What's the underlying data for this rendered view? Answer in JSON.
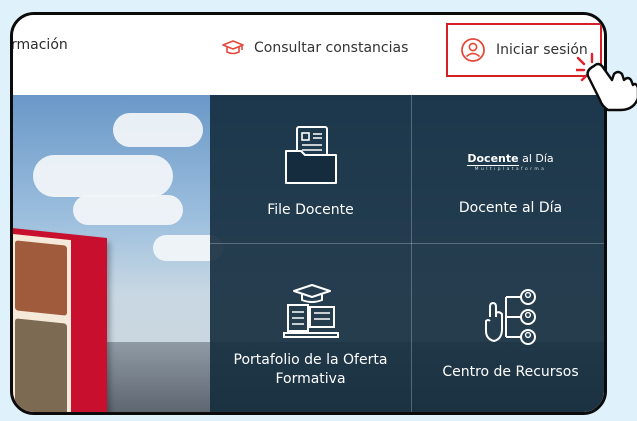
{
  "header": {
    "brand_fragment": "rmación",
    "consultar_label": "Consultar constancias",
    "login_label": "Iniciar sesión"
  },
  "tiles": [
    {
      "label": "File Docente",
      "icon": "folder-file-icon"
    },
    {
      "label": "Docente al Día",
      "icon": "docente-al-dia-logo"
    },
    {
      "label": "Portafolio de la Oferta Formativa",
      "icon": "graduation-laptop-icon"
    },
    {
      "label": "Centro de Recursos",
      "icon": "network-users-icon"
    }
  ],
  "docente_logo": {
    "bold": "Docente",
    "rest": " al Día",
    "sub": "Multiplataforma"
  },
  "colors": {
    "accent_red": "#d61f26",
    "panel_navy": "#142c3e",
    "outer_bg": "#dff1fb"
  }
}
